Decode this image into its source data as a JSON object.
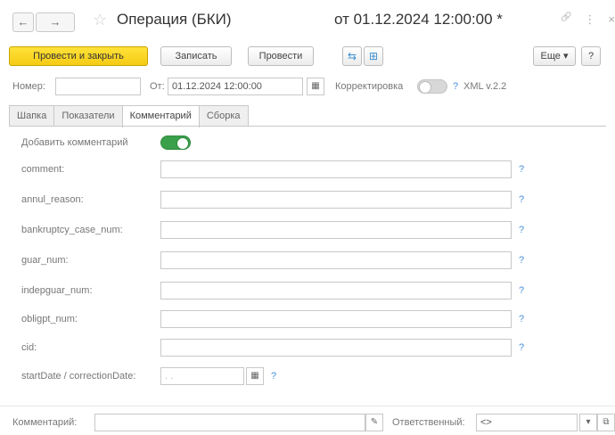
{
  "window": {
    "title": "Операция (БКИ)",
    "title_date": "от 01.12.2024 12:00:00 *",
    "back_glyph": "←",
    "forward_glyph": "→",
    "star_glyph": "☆",
    "link_glyph": "🔗",
    "more_glyph": "⋮",
    "close_glyph": "×"
  },
  "toolbar": {
    "post_close_label": "Провести и закрыть",
    "save_label": "Записать",
    "post_label": "Провести",
    "icon1_glyph": "⇆",
    "icon2_glyph": "⊞",
    "more_label": "Еще ▾",
    "help_label": "?"
  },
  "header_fields": {
    "number_label": "Номер:",
    "number_value": "",
    "date_label": "От:",
    "date_value": "01.12.2024 12:00:00",
    "correction_label": "Корректировка",
    "correction_on": false,
    "help_mark": "?",
    "xml_label": "XML v.2.2"
  },
  "tabs": [
    {
      "label": "Шапка",
      "active": false
    },
    {
      "label": "Показатели",
      "active": false
    },
    {
      "label": "Комментарий",
      "active": true
    },
    {
      "label": "Сборка",
      "active": false
    }
  ],
  "comment_tab": {
    "add_comment_label": "Добавить комментарий",
    "add_comment_on": true,
    "fields": [
      {
        "label": "comment:",
        "value": ""
      },
      {
        "label": "annul_reason:",
        "value": ""
      },
      {
        "label": "bankruptcy_case_num:",
        "value": ""
      },
      {
        "label": "guar_num:",
        "value": ""
      },
      {
        "label": "indepguar_num:",
        "value": ""
      },
      {
        "label": "obligpt_num:",
        "value": ""
      },
      {
        "label": "cid:",
        "value": ""
      }
    ],
    "date_field_label": "startDate / correctionDate:",
    "date_field_value": "  .  .",
    "help_mark": "?"
  },
  "footer": {
    "comment_label": "Комментарий:",
    "comment_value": "",
    "responsible_label": "Ответственный:",
    "responsible_value": "<>"
  },
  "colors": {
    "primary_button": "#f5cb13",
    "toggle_on": "#3aa04a",
    "help_blue": "#4a90d9"
  }
}
